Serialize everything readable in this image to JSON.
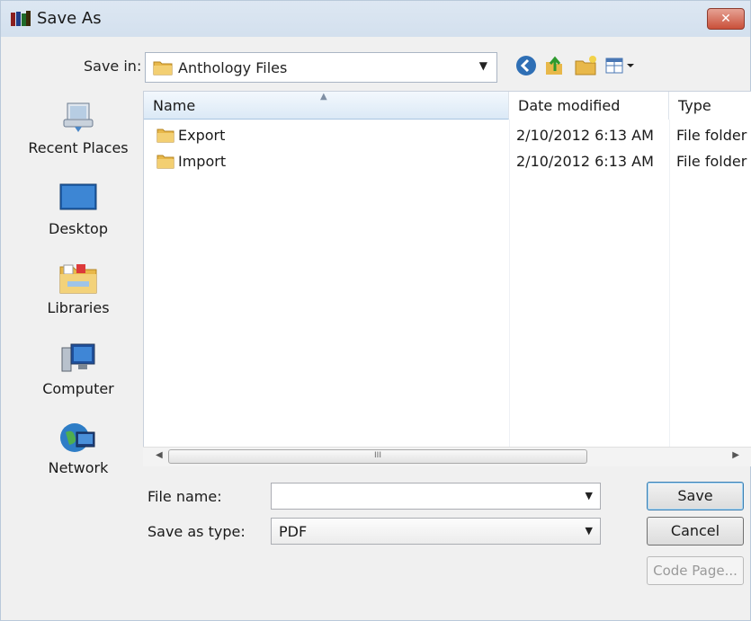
{
  "window": {
    "title": "Save As"
  },
  "save_in": {
    "label": "Save in:",
    "value": "Anthology Files"
  },
  "places": [
    {
      "label": "Recent Places",
      "icon": "recent-places-icon"
    },
    {
      "label": "Desktop",
      "icon": "desktop-icon"
    },
    {
      "label": "Libraries",
      "icon": "libraries-icon"
    },
    {
      "label": "Computer",
      "icon": "computer-icon"
    },
    {
      "label": "Network",
      "icon": "network-icon"
    }
  ],
  "file_list": {
    "columns": [
      "Name",
      "Date modified",
      "Type"
    ],
    "rows": [
      {
        "name": "Export",
        "date": "2/10/2012 6:13 AM",
        "type": "File folder"
      },
      {
        "name": "Import",
        "date": "2/10/2012 6:13 AM",
        "type": "File folder"
      }
    ],
    "scroll_grip": "III"
  },
  "file_name": {
    "label": "File name:",
    "value": ""
  },
  "save_as_type": {
    "label": "Save as type:",
    "value": "PDF"
  },
  "buttons": {
    "save": "Save",
    "cancel": "Cancel",
    "code_page": "Code Page..."
  },
  "colors": {
    "title_bar": "#d3e0ee",
    "close_button": "#c9503a",
    "folder": "#e8b84a"
  }
}
